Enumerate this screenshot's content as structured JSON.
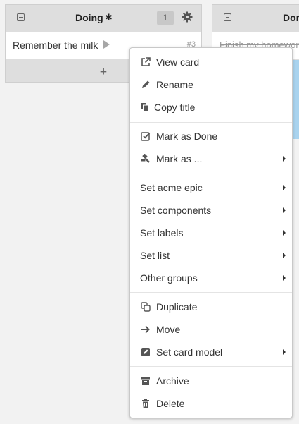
{
  "lists": {
    "doing": {
      "title": "Doing",
      "count": "1",
      "card": {
        "title": "Remember the milk",
        "number": "#3"
      }
    },
    "done": {
      "title": "Done",
      "card": {
        "title": "Finish my homework"
      }
    }
  },
  "menu": {
    "view_card": "View card",
    "rename": "Rename",
    "copy_title": "Copy title",
    "mark_as_done": "Mark as Done",
    "mark_as": "Mark as ...",
    "set_acme_epic": "Set acme epic",
    "set_components": "Set components",
    "set_labels": "Set labels",
    "set_list": "Set list",
    "other_groups": "Other groups",
    "duplicate": "Duplicate",
    "move": "Move",
    "set_card_model": "Set card model",
    "archive": "Archive",
    "delete": "Delete"
  }
}
